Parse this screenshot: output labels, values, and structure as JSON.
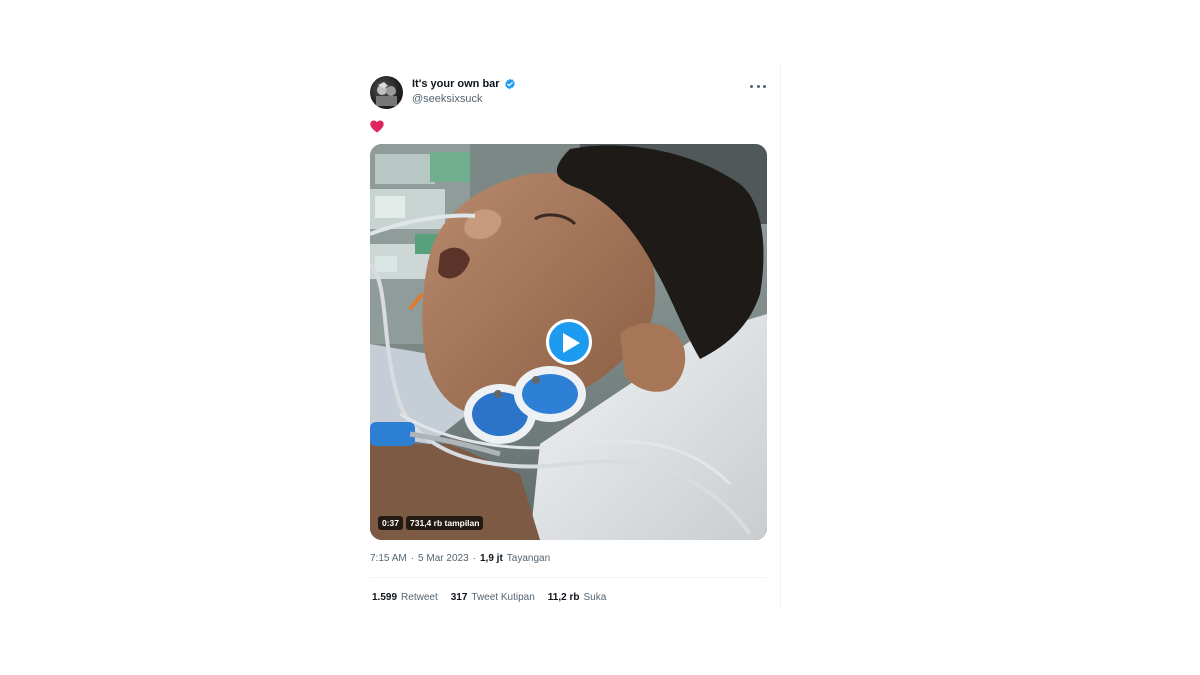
{
  "author": {
    "display_name": "It's your own bar",
    "handle": "@seeksixsuck",
    "verified": true,
    "avatar_icon": "profile-photo"
  },
  "content": {
    "emoji_icon": "red-heart-icon",
    "emoji_color": "#f91880"
  },
  "video": {
    "duration": "0:37",
    "views": "731,4 rb tampilan",
    "play_icon": "play-icon"
  },
  "meta": {
    "time": "7:15 AM",
    "separator": "·",
    "date": "5 Mar 2023",
    "views_count": "1,9 jt",
    "views_label": "Tayangan"
  },
  "stats": {
    "retweets_count": "1.599",
    "retweets_label": "Retweet",
    "quotes_count": "317",
    "quotes_label": "Tweet Kutipan",
    "likes_count": "11,2 rb",
    "likes_label": "Suka"
  },
  "colors": {
    "accent": "#1d9bf0",
    "text_primary": "#0f1419",
    "text_secondary": "#536471"
  }
}
